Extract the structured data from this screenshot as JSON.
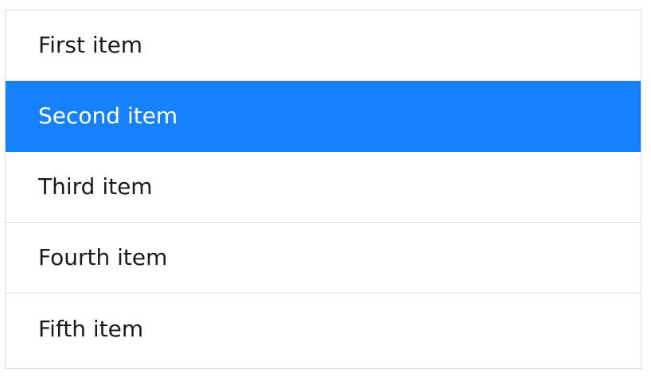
{
  "list": {
    "items": [
      {
        "label": "First item",
        "active": false
      },
      {
        "label": "Second item",
        "active": true
      },
      {
        "label": "Third item",
        "active": false
      },
      {
        "label": "Fourth item",
        "active": false
      },
      {
        "label": "Fifth item",
        "active": false
      }
    ]
  },
  "colors": {
    "active_background": "#1780fb",
    "active_text": "#ffffff",
    "text": "#1a1a1a",
    "border": "#d9d9d9"
  }
}
